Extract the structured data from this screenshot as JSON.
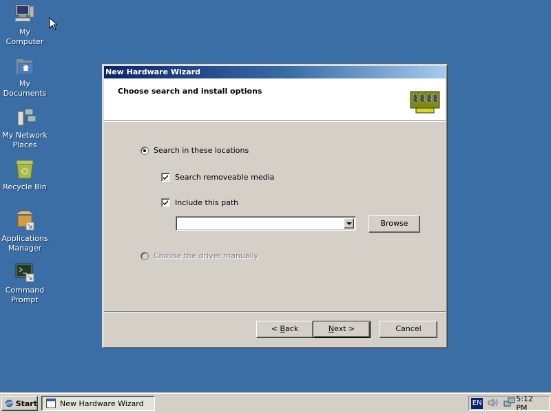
{
  "desktop": {
    "icons": [
      {
        "label_line1": "My",
        "label_line2": "Computer",
        "icon": "computer-icon"
      },
      {
        "label_line1": "My",
        "label_line2": "Documents",
        "icon": "documents-folder-icon"
      },
      {
        "label_line1": "My Network",
        "label_line2": "Places",
        "icon": "network-places-icon"
      },
      {
        "label_line1": "Recycle Bin",
        "label_line2": "",
        "icon": "recycle-bin-icon"
      },
      {
        "label_line1": "Applications",
        "label_line2": "Manager",
        "icon": "applications-manager-icon"
      },
      {
        "label_line1": "Command",
        "label_line2": "Prompt",
        "icon": "command-prompt-icon"
      }
    ]
  },
  "wizard": {
    "title": "New Hardware Wizard",
    "header_title": "Choose search and install options",
    "options": {
      "search_locations": {
        "label": "Search in these locations",
        "selected": true
      },
      "removable_media": {
        "label": "Search removeable media",
        "checked": true
      },
      "include_path": {
        "label": "Include this path",
        "checked": true
      },
      "path_value": "",
      "choose_manually": {
        "label": "Choose the driver manually",
        "selected": false,
        "enabled": false
      }
    },
    "buttons": {
      "browse": "Browse",
      "back_prefix": "< ",
      "back_mnemonic": "B",
      "back_rest": "ack",
      "next_mnemonic": "N",
      "next_rest": "ext >",
      "cancel": "Cancel"
    }
  },
  "taskbar": {
    "start_label": "Start",
    "tasks": [
      {
        "label": "New Hardware Wizard"
      }
    ],
    "tray": {
      "language": "EN",
      "clock": "5:12 PM"
    }
  }
}
